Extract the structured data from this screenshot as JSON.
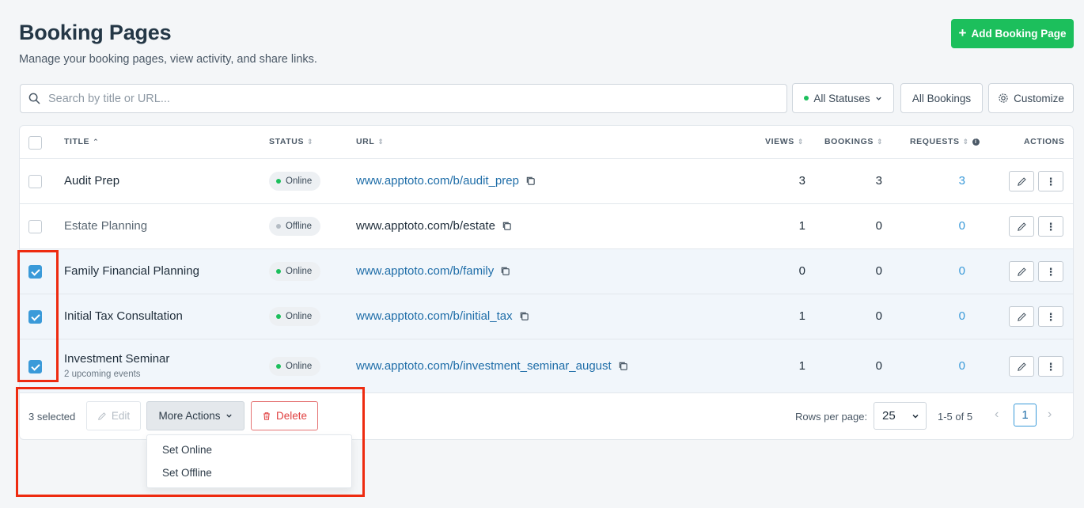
{
  "header": {
    "title": "Booking Pages",
    "subtitle": "Manage your booking pages, view activity, and share links.",
    "add_button": "Add Booking Page"
  },
  "toolbar": {
    "search_placeholder": "Search by title or URL...",
    "status_filter": "All Statuses",
    "bookings_filter": "All Bookings",
    "customize": "Customize"
  },
  "table": {
    "columns": {
      "title": "TITLE",
      "status": "STATUS",
      "url": "URL",
      "views": "VIEWS",
      "bookings": "BOOKINGS",
      "requests": "REQUESTS",
      "actions": "ACTIONS"
    },
    "rows": [
      {
        "title": "Audit Prep",
        "subtitle": "",
        "status": "Online",
        "url": "www.apptoto.com/b/audit_prep",
        "views": "3",
        "bookings": "3",
        "requests": "3",
        "checked": false
      },
      {
        "title": "Estate Planning",
        "subtitle": "",
        "status": "Offline",
        "url": "www.apptoto.com/b/estate",
        "views": "1",
        "bookings": "0",
        "requests": "0",
        "checked": false
      },
      {
        "title": "Family Financial Planning",
        "subtitle": "",
        "status": "Online",
        "url": "www.apptoto.com/b/family",
        "views": "0",
        "bookings": "0",
        "requests": "0",
        "checked": true
      },
      {
        "title": "Initial Tax Consultation",
        "subtitle": "",
        "status": "Online",
        "url": "www.apptoto.com/b/initial_tax",
        "views": "1",
        "bookings": "0",
        "requests": "0",
        "checked": true
      },
      {
        "title": "Investment Seminar",
        "subtitle": "2 upcoming events",
        "status": "Online",
        "url": "www.apptoto.com/b/investment_seminar_august",
        "views": "1",
        "bookings": "0",
        "requests": "0",
        "checked": true
      }
    ]
  },
  "footer": {
    "selected_count": "3 selected",
    "edit": "Edit",
    "more_actions": "More Actions",
    "delete": "Delete",
    "rows_per_page_label": "Rows per page:",
    "rows_per_page": "25",
    "range": "1-5 of 5",
    "page": "1"
  },
  "more_actions_menu": [
    "Set Online",
    "Set Offline"
  ],
  "colors": {
    "accent_green": "#1cbf5c",
    "link_blue": "#1e6da8",
    "checkbox_blue": "#3a9ad9",
    "delete_red": "#e04040",
    "highlight_red": "#ee2b10"
  }
}
